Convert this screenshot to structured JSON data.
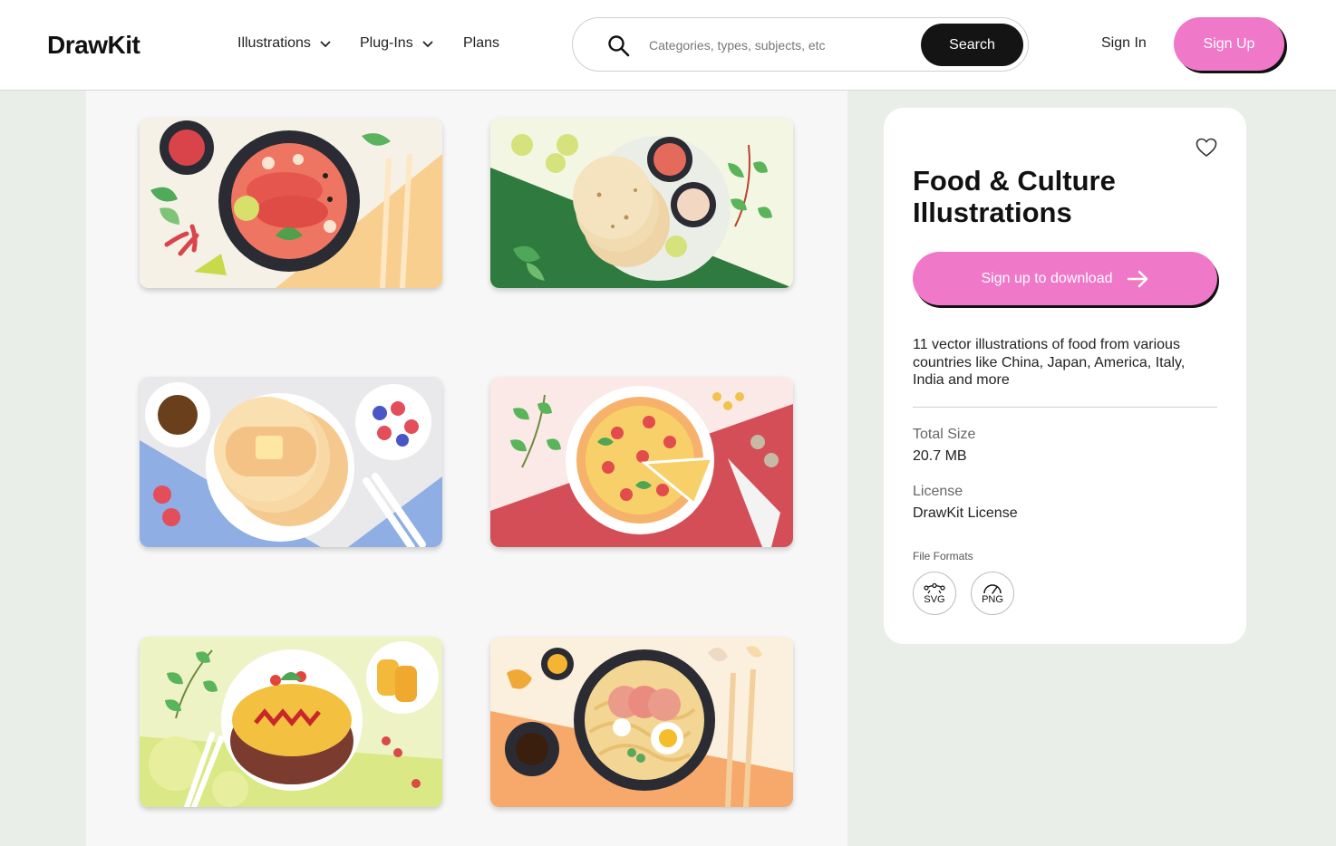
{
  "header": {
    "logo": "DrawKit",
    "nav": [
      {
        "label": "Illustrations",
        "has_dropdown": true
      },
      {
        "label": "Plug-Ins",
        "has_dropdown": true
      },
      {
        "label": "Plans",
        "has_dropdown": false
      }
    ],
    "search": {
      "placeholder": "Categories, types, subjects, etc",
      "value": "",
      "button_label": "Search"
    },
    "sign_in": "Sign In",
    "sign_up": "Sign Up"
  },
  "gallery": {
    "cards": [
      {
        "subject": "shrimp curry bowl"
      },
      {
        "subject": "flatbread with dips"
      },
      {
        "subject": "pancakes with berries"
      },
      {
        "subject": "pizza"
      },
      {
        "subject": "omurice"
      },
      {
        "subject": "ramen"
      }
    ]
  },
  "details": {
    "title": "Food & Culture Illustrations",
    "download_button": "Sign up to download",
    "description": "11 vector illustrations of food from various countries like China, Japan, America, Italy, India and more",
    "total_size_label": "Total Size",
    "total_size_value": "20.7 MB",
    "license_label": "License",
    "license_value": "DrawKit License",
    "file_formats_label": "File Formats",
    "formats": [
      "SVG",
      "PNG"
    ]
  },
  "colors": {
    "accent": "#f078c8",
    "dark": "#141414"
  }
}
